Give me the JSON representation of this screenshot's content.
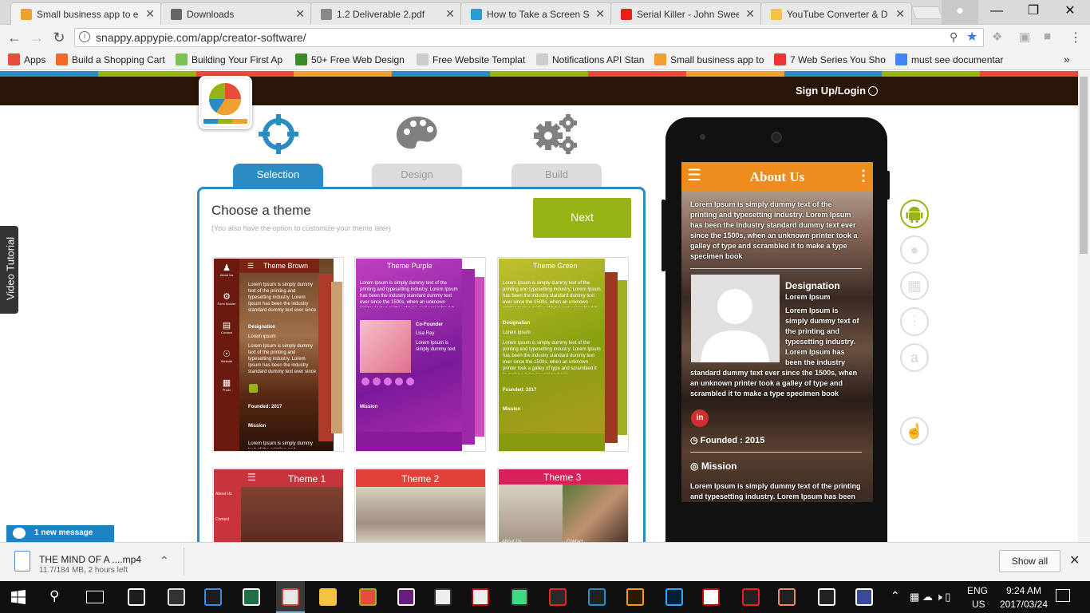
{
  "browser": {
    "tabs": [
      {
        "title": "Small business app to e",
        "active": true,
        "color": "#f0a030"
      },
      {
        "title": "Downloads",
        "active": false,
        "color": "#666666"
      },
      {
        "title": "1.2 Deliverable 2.pdf",
        "active": false,
        "color": "#888888"
      },
      {
        "title": "How to Take a Screen Sh",
        "active": false,
        "color": "#2b9bd8"
      },
      {
        "title": "Serial Killer - John Swee",
        "active": false,
        "color": "#e62117"
      },
      {
        "title": "YouTube Converter & D",
        "active": false,
        "color": "#f5c242"
      }
    ],
    "url": "snappy.appypie.com/app/creator-software/",
    "bookmarks": [
      {
        "label": "Apps",
        "color": "#e84c3d"
      },
      {
        "label": "Build a Shopping Cart",
        "color": "#f06a2a"
      },
      {
        "label": "Building Your First Ap",
        "color": "#78c257"
      },
      {
        "label": "50+ Free Web Design",
        "color": "#3a8a2a"
      },
      {
        "label": "Free Website Templat",
        "color": "#cccccc"
      },
      {
        "label": "Notifications API Stan",
        "color": "#cccccc"
      },
      {
        "label": "Small business app to",
        "color": "#f0a030"
      },
      {
        "label": "7 Web Series You Sho",
        "color": "#e33"
      },
      {
        "label": "must see documentar",
        "color": "#4285f4"
      }
    ],
    "overflow": "»"
  },
  "site": {
    "signup": "Sign Up/Login",
    "video_tutorial": "Video Tutorial",
    "steps": [
      {
        "label": "Selection",
        "active": true
      },
      {
        "label": "Design",
        "active": false
      },
      {
        "label": "Build",
        "active": false
      }
    ],
    "choose_title": "Choose a theme",
    "choose_sub": "(You also have the option to customize your theme later)",
    "next": "Next",
    "themes": [
      {
        "name": "Theme Brown",
        "color": "#6b1a0f"
      },
      {
        "name": "Theme Purple",
        "color": "#b02fb0"
      },
      {
        "name": "Theme Green",
        "color": "#a0b41a"
      },
      {
        "name": "Theme 1",
        "color": "#c8343c"
      },
      {
        "name": "Theme 2",
        "color": "#e2403a"
      },
      {
        "name": "Theme 3",
        "color": "#d8205a"
      }
    ],
    "brown_nav": [
      "About Us",
      "Form Builder",
      "Contact",
      "Website",
      "Photo"
    ],
    "theme_lorem": "Lorem Ipsum is simply dummy text of the printing and typesetting industry. Lorem Ipsum has been the industry standard dummy text ever since the 1500s, when an unknown printer took a galley of type and scrambled it to make a type specimen book",
    "theme_labels": {
      "designation": "Designation",
      "lorem": "Lorem ipsum",
      "cofounder": "Co-Founder",
      "lisa": "Lisa Ray",
      "founded": "Founded: 2017",
      "mission": "Mission",
      "aboutus": "About Us",
      "contact": "Contact"
    }
  },
  "phone": {
    "title": "About Us",
    "intro": "Lorem Ipsum is simply dummy text of the printing and typesetting industry. Lorem Ipsum has been the industry standard dummy text ever since the 1500s, when an unknown printer took a galley of type and scrambled it to make a type specimen book",
    "designation": "Designation",
    "desig_name": "Lorem Ipsum",
    "desig_text_a": "Lorem Ipsum is simply dummy text of the printing and typesetting industry. Lorem Ipsum has been the industry",
    "desig_text_b": "standard dummy text ever since the 1500s, when an unknown printer took a galley of type and scrambled it to make a type specimen book",
    "founded": "Founded : 2015",
    "mission": "Mission",
    "mission_text": "Lorem Ipsum is simply dummy text of the printing and typesetting industry. Lorem Ipsum has been"
  },
  "chat": {
    "label": "1 new message"
  },
  "download": {
    "name": "THE MIND OF A ....mp4",
    "status": "11.7/184 MB, 2 hours left",
    "show_all": "Show all"
  },
  "taskbar": {
    "lang": "ENG",
    "region": "US",
    "time": "9:24 AM",
    "date": "2017/03/24"
  }
}
